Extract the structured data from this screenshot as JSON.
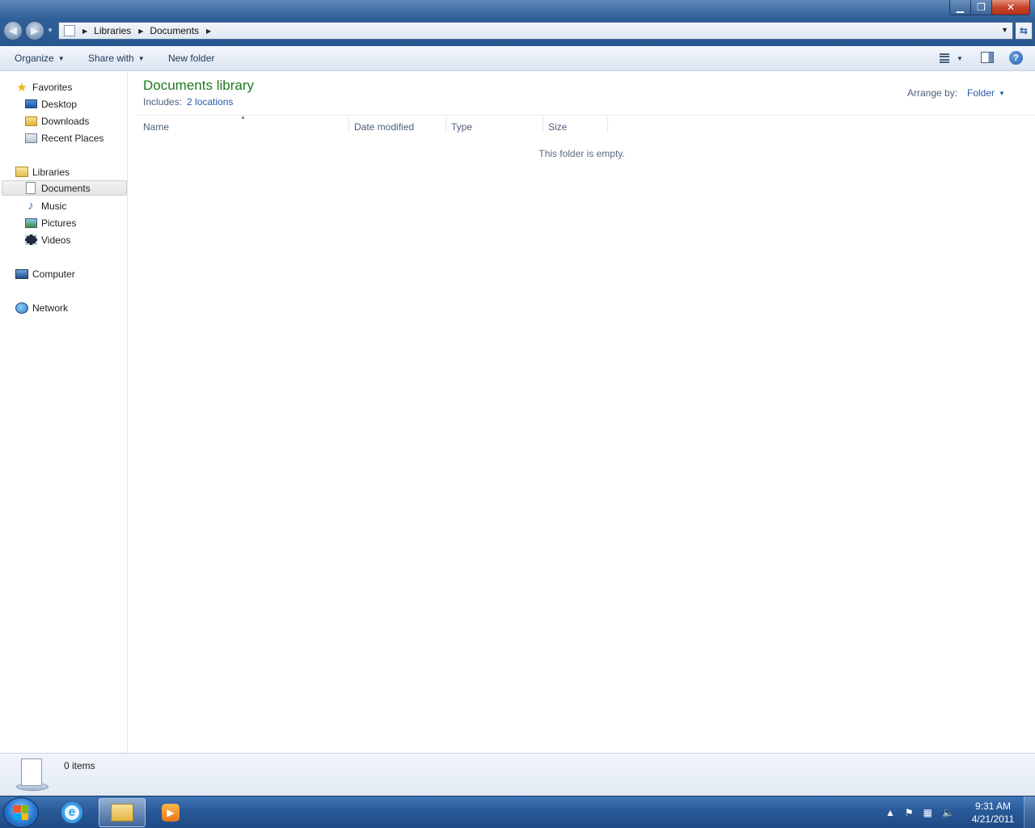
{
  "address": {
    "crumbs": [
      "Libraries",
      "Documents"
    ]
  },
  "toolbar": {
    "organize_label": "Organize",
    "share_label": "Share with",
    "new_folder_label": "New folder"
  },
  "sidebar": {
    "favorites": {
      "label": "Favorites",
      "items": [
        {
          "label": "Desktop",
          "icon": "desktop-icon"
        },
        {
          "label": "Downloads",
          "icon": "folder-icon"
        },
        {
          "label": "Recent Places",
          "icon": "recent-places-icon"
        }
      ]
    },
    "libraries": {
      "label": "Libraries",
      "items": [
        {
          "label": "Documents",
          "icon": "documents-icon",
          "selected": true
        },
        {
          "label": "Music",
          "icon": "music-icon"
        },
        {
          "label": "Pictures",
          "icon": "pictures-icon"
        },
        {
          "label": "Videos",
          "icon": "videos-icon"
        }
      ]
    },
    "computer": {
      "label": "Computer"
    },
    "network": {
      "label": "Network"
    }
  },
  "main": {
    "title": "Documents library",
    "includes_label": "Includes:",
    "includes_link": "2 locations",
    "arrange_label": "Arrange by:",
    "arrange_value": "Folder",
    "columns": [
      "Name",
      "Date modified",
      "Type",
      "Size"
    ],
    "empty_message": "This folder is empty."
  },
  "details": {
    "count": "0 items"
  },
  "taskbar": {
    "time": "9:31 AM",
    "date": "4/21/2011"
  },
  "colors": {
    "title_green": "#1e7a1e",
    "link_blue": "#2a5aa8",
    "taskbar": "#2a5a98"
  }
}
